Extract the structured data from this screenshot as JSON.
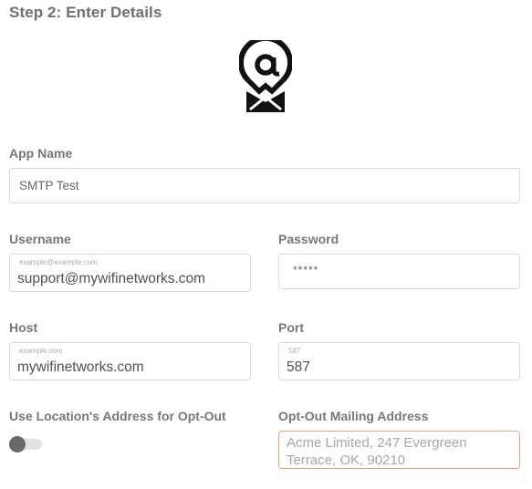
{
  "step": {
    "title": "Step 2: Enter Details"
  },
  "logo": {
    "icon": "smtp-at-envelope-icon"
  },
  "form": {
    "app_name": {
      "label": "App Name",
      "value": "SMTP Test"
    },
    "username": {
      "label": "Username",
      "hint": "example@example.com",
      "value": "support@mywifinetworks.com"
    },
    "password": {
      "label": "Password",
      "value": "*****"
    },
    "host": {
      "label": "Host",
      "hint": "example.com",
      "value": "mywifinetworks.com"
    },
    "port": {
      "label": "Port",
      "hint": "587",
      "value": "587"
    },
    "use_location": {
      "label": "Use Location's Address for Opt-Out",
      "toggled": false
    },
    "opt_out": {
      "label": "Opt-Out Mailing Address",
      "placeholder": "Acme Limited, 247 Evergreen Terrace, OK, 90210"
    }
  },
  "colors": {
    "focus_border": "#e8a083",
    "label": "#777777",
    "toggle_knob": "#6a6a6a"
  }
}
